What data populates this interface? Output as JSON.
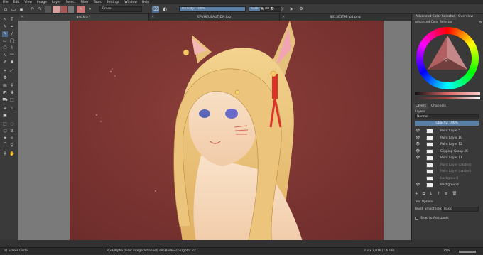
{
  "menu": [
    "File",
    "Edit",
    "View",
    "Image",
    "Layer",
    "Select",
    "Filter",
    "Tools",
    "Settings",
    "Window",
    "Help"
  ],
  "toolbar": {
    "blend_mode": "Erase",
    "opacity_label": "Opacity: 100%",
    "opacity_fraction": 1.0,
    "size_label": "Size: 50.00 px",
    "size_fraction": 0.35
  },
  "tabs": [
    "gsc.kra *",
    "EPVHEUEAUTIDN.jpg",
    "IJB1301TMI_p1.png"
  ],
  "color_panel": {
    "tabs": [
      "Advanced Color Selector",
      "Overview"
    ],
    "title": "Advanced Color Selector",
    "accent": "#cf4a5a"
  },
  "layers_panel": {
    "tabs": [
      "Layers",
      "Channels"
    ],
    "header": "Layers",
    "blend": "Normal",
    "opacity_label": "Opacity: 100%",
    "layers": [
      {
        "name": "Paint Layer 5",
        "visible": true,
        "selected": false,
        "dim": false
      },
      {
        "name": "Paint Layer 10",
        "visible": true,
        "selected": false,
        "dim": false
      },
      {
        "name": "Paint Layer 12",
        "visible": true,
        "selected": false,
        "dim": false
      },
      {
        "name": "Clipping Group 46",
        "visible": true,
        "selected": false,
        "dim": false
      },
      {
        "name": "Paint Layer 11",
        "visible": true,
        "selected": false,
        "dim": false
      },
      {
        "name": "Paint Layer (pasted)",
        "visible": false,
        "selected": false,
        "dim": true
      },
      {
        "name": "Paint Layer (pasted)",
        "visible": false,
        "selected": false,
        "dim": true
      },
      {
        "name": "background",
        "visible": false,
        "selected": false,
        "dim": true
      },
      {
        "name": "Background",
        "visible": true,
        "selected": false,
        "dim": false
      }
    ]
  },
  "tool_options": {
    "title": "Tool Options",
    "smoothing_label": "Brush Smoothing:",
    "smoothing_value": "Basic",
    "snap_label": "Snap to Assistants"
  },
  "status": {
    "brush": "a) Eraser Circle",
    "color_info": "RGB/Alpha (8-bit integer/channel)  sRGB-elle-V2-srgbtrc.icc",
    "size_info": "3.3 x 7,016 (1.6 GB)",
    "zoom": "25%"
  }
}
